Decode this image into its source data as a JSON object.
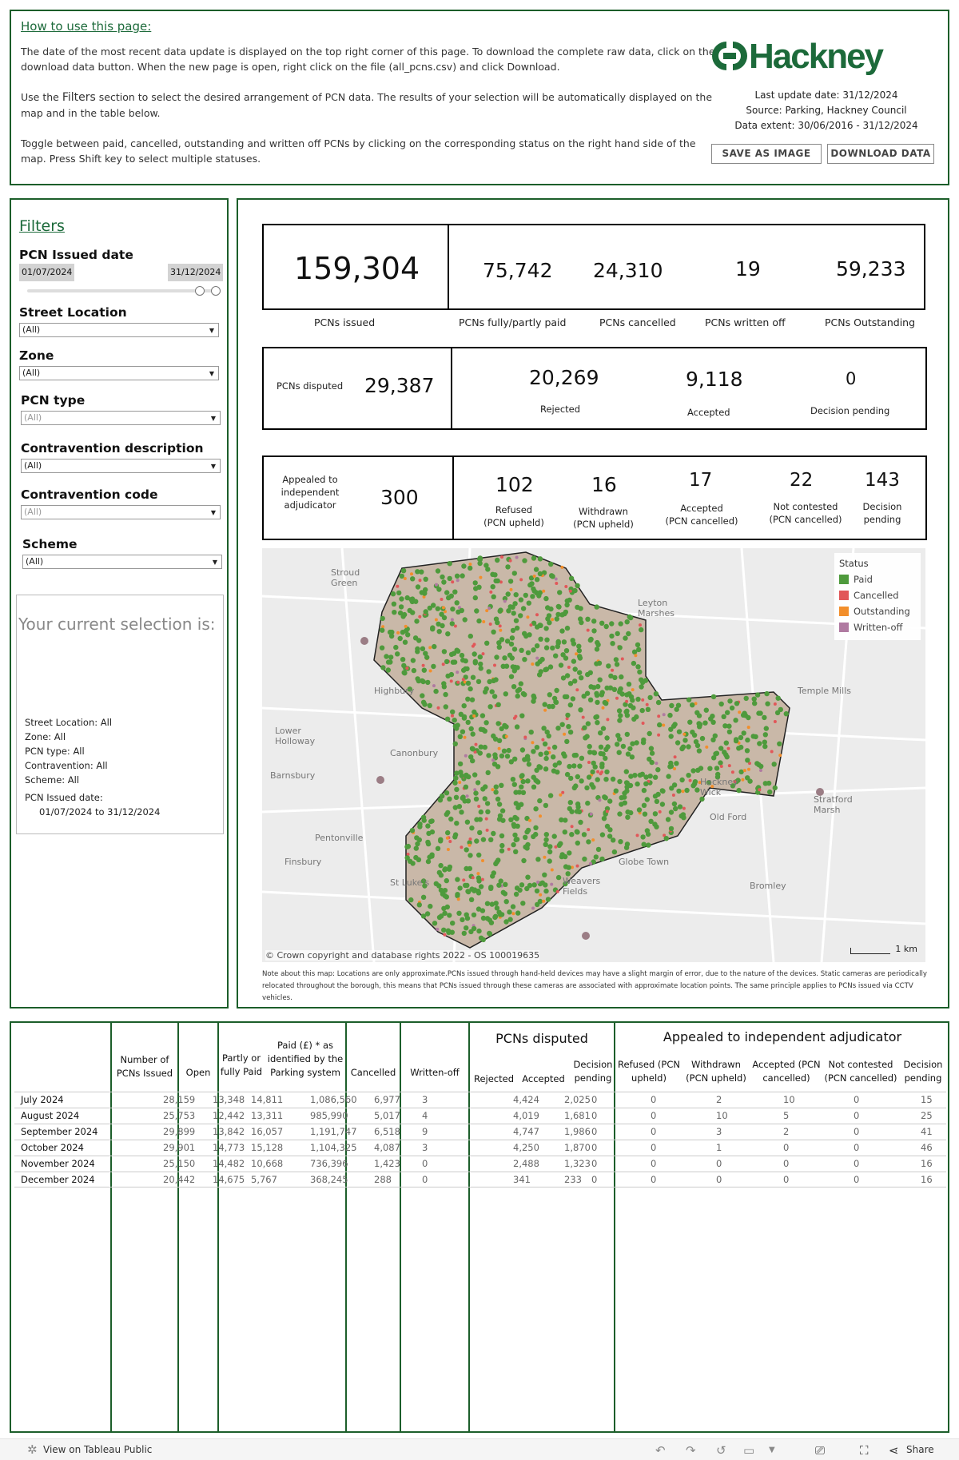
{
  "intro": {
    "title": "How to use this page:",
    "p1": "The date of the most recent data update is displayed on the top right corner of this page. To download the complete raw data, click on the download  data button. When the new page is open, right click on the file (all_pcns.csv) and click Download.",
    "p2a": "Use the ",
    "p2b": "Filters",
    "p2c": " section to select the desired arrangement of PCN data. The results of your selection will be automatically displayed on the map and in the table below.",
    "p3": "Toggle between paid, cancelled, outstanding and written off PCNs by clicking on the corresponding status on the right hand side of the map. Press Shift key to select multiple statuses."
  },
  "brand": {
    "name": "Hackney",
    "color": "#1c6a3a"
  },
  "meta": {
    "last_update": "Last update date: 31/12/2024",
    "source": "Source: Parking, Hackney Council",
    "extent": "Data extent: 30/06/2016 - 31/12/2024"
  },
  "buttons": {
    "save": "SAVE AS IMAGE",
    "download": "DOWNLOAD DATA"
  },
  "filters": {
    "title": "Filters",
    "issued_date_label": "PCN Issued date",
    "date_start": "01/07/2024",
    "date_end": "31/12/2024",
    "street_label": "Street Location",
    "street_value": "(All)",
    "zone_label": "Zone",
    "zone_value": "(All)",
    "type_label": "PCN type",
    "type_value": "(All)",
    "contra_desc_label": "Contravention description",
    "contra_desc_value": "(All)",
    "contra_code_label": "Contravention code",
    "contra_code_value": "(All)",
    "scheme_label": "Scheme",
    "scheme_value": "(All)"
  },
  "selection": {
    "title": "Your current selection is:",
    "street": "Street Location: All",
    "zone": "Zone: All",
    "type": "PCN type: All",
    "contravention": "Contravention: All",
    "scheme": "Scheme: All",
    "date_label": "PCN Issued date:",
    "date_range": "01/07/2024 to 31/12/2024"
  },
  "kpis": {
    "issued": {
      "value": "159,304",
      "label": "PCNs issued"
    },
    "paid": {
      "value": "75,742",
      "label": "PCNs fully/partly paid"
    },
    "cancelled": {
      "value": "24,310",
      "label": "PCNs cancelled"
    },
    "written_off": {
      "value": "19",
      "label": "PCNs written off"
    },
    "outstanding": {
      "value": "59,233",
      "label": "PCNs Outstanding"
    }
  },
  "disputed": {
    "label": "PCNs disputed",
    "value": "29,387",
    "rejected": {
      "value": "20,269",
      "label": "Rejected"
    },
    "accepted": {
      "value": "9,118",
      "label": "Accepted"
    },
    "pending": {
      "value": "0",
      "label": "Decision pending"
    }
  },
  "appealed": {
    "label": "Appealed to independent adjudicator",
    "value": "300",
    "refused": {
      "value": "102",
      "label1": "Refused",
      "label2": "(PCN upheld)"
    },
    "withdrawn": {
      "value": "16",
      "label1": "Withdrawn",
      "label2": "(PCN upheld)"
    },
    "accepted": {
      "value": "17",
      "label1": "Accepted",
      "label2": "(PCN cancelled)"
    },
    "not_contested": {
      "value": "22",
      "label1": "Not contested",
      "label2": "(PCN cancelled)"
    },
    "pending": {
      "value": "143",
      "label1": "Decision",
      "label2": "pending"
    }
  },
  "map": {
    "legend_title": "Status",
    "legend": [
      {
        "label": "Paid",
        "color": "#4e9a3c"
      },
      {
        "label": "Cancelled",
        "color": "#e15759"
      },
      {
        "label": "Outstanding",
        "color": "#f28e2b"
      },
      {
        "label": "Written-off",
        "color": "#b07aa1"
      }
    ],
    "place_labels": [
      "Stroud Green",
      "Leyton Marshes",
      "Highbury",
      "Lower Holloway",
      "Canonbury",
      "Barnsbury",
      "Pentonville",
      "Finsbury",
      "St Luke's",
      "Weavers Fields",
      "Globe Town",
      "Old Ford",
      "Hackney Wick",
      "Stratford Marsh",
      "Temple Mills",
      "Bromley"
    ],
    "copyright": "© Crown copyright and database rights 2022 - OS 100019635",
    "scale": "1 km",
    "note": "Note about this map: Locations are only approximate.PCNs issued through hand-held devices may have a slight margin of error, due to the nature of the devices. Static cameras are periodically relocated throughout the borough, this means that PCNs issued through these cameras are associated with approximate location points. The same principle applies to PCNs issued via CCTV vehicles."
  },
  "table": {
    "group_disputed": "PCNs disputed",
    "group_appealed": "Appealed to independent adjudicator",
    "headers": {
      "issued": "Number of PCNs Issued",
      "open": "Open",
      "paid": "Partly or fully Paid",
      "paid_amount": "Paid (£) * as identified by the Parking system",
      "cancelled": "Cancelled",
      "written_off": "Written-off",
      "rejected": "Rejected",
      "accepted": "Accepted",
      "pending": "Decision pending",
      "refused": "Refused (PCN upheld)",
      "withdrawn": "Withdrawn (PCN upheld)",
      "adj_accepted": "Accepted (PCN cancelled)",
      "not_contested": "Not contested (PCN cancelled)",
      "adj_pending": "Decision pending"
    },
    "rows": [
      {
        "month": "July 2024",
        "issued": "28,159",
        "open": "13,348",
        "paid": "14,811",
        "amount": "1,086,560",
        "cancelled": "6,977",
        "written_off": "3",
        "rejected": "4,424",
        "accepted": "2,025",
        "pending": "0",
        "refused": "0",
        "withdrawn": "2",
        "adj_accepted": "10",
        "not_contested": "0",
        "adj_pending": "15"
      },
      {
        "month": "August 2024",
        "issued": "25,753",
        "open": "12,442",
        "paid": "13,311",
        "amount": "985,990",
        "cancelled": "5,017",
        "written_off": "4",
        "rejected": "4,019",
        "accepted": "1,681",
        "pending": "0",
        "refused": "0",
        "withdrawn": "10",
        "adj_accepted": "5",
        "not_contested": "0",
        "adj_pending": "25"
      },
      {
        "month": "September 2024",
        "issued": "29,899",
        "open": "13,842",
        "paid": "16,057",
        "amount": "1,191,747",
        "cancelled": "6,518",
        "written_off": "9",
        "rejected": "4,747",
        "accepted": "1,986",
        "pending": "0",
        "refused": "0",
        "withdrawn": "3",
        "adj_accepted": "2",
        "not_contested": "0",
        "adj_pending": "41"
      },
      {
        "month": "October 2024",
        "issued": "29,901",
        "open": "14,773",
        "paid": "15,128",
        "amount": "1,104,325",
        "cancelled": "4,087",
        "written_off": "3",
        "rejected": "4,250",
        "accepted": "1,870",
        "pending": "0",
        "refused": "0",
        "withdrawn": "1",
        "adj_accepted": "0",
        "not_contested": "0",
        "adj_pending": "46"
      },
      {
        "month": "November 2024",
        "issued": "25,150",
        "open": "14,482",
        "paid": "10,668",
        "amount": "736,396",
        "cancelled": "1,423",
        "written_off": "0",
        "rejected": "2,488",
        "accepted": "1,323",
        "pending": "0",
        "refused": "0",
        "withdrawn": "0",
        "adj_accepted": "0",
        "not_contested": "0",
        "adj_pending": "16"
      },
      {
        "month": "December 2024",
        "issued": "20,442",
        "open": "14,675",
        "paid": "5,767",
        "amount": "368,245",
        "cancelled": "288",
        "written_off": "0",
        "rejected": "341",
        "accepted": "233",
        "pending": "0",
        "refused": "0",
        "withdrawn": "0",
        "adj_accepted": "0",
        "not_contested": "0",
        "adj_pending": "16"
      }
    ]
  },
  "footer": {
    "view_link": "View on Tableau Public",
    "share": "Share"
  }
}
